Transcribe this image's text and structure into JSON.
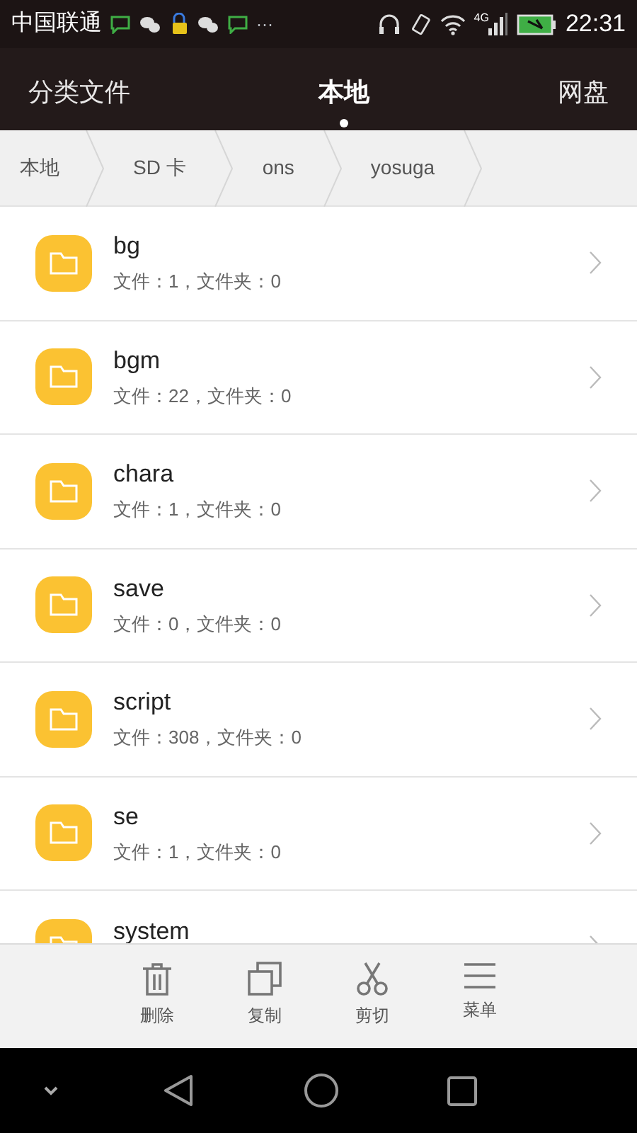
{
  "status_bar": {
    "carrier": "中国联通",
    "more": "···",
    "network": "4G",
    "time": "22:31"
  },
  "tabs": [
    {
      "label": "分类文件",
      "selected": false
    },
    {
      "label": "本地",
      "selected": true
    },
    {
      "label": "网盘",
      "selected": false
    }
  ],
  "breadcrumb": [
    "本地",
    "SD 卡",
    "ons",
    "yosuga"
  ],
  "folders": [
    {
      "name": "bg",
      "info": "文件：1，文件夹：0"
    },
    {
      "name": "bgm",
      "info": "文件：22，文件夹：0"
    },
    {
      "name": "chara",
      "info": "文件：1，文件夹：0"
    },
    {
      "name": "save",
      "info": "文件：0，文件夹：0"
    },
    {
      "name": "script",
      "info": "文件：308，文件夹：0"
    },
    {
      "name": "se",
      "info": "文件：1，文件夹：0"
    },
    {
      "name": "system"
    }
  ],
  "toolbar": [
    {
      "kind": "delete",
      "label": "删除"
    },
    {
      "kind": "copy",
      "label": "复制"
    },
    {
      "kind": "cut",
      "label": "剪切"
    },
    {
      "kind": "menu",
      "label": "菜单"
    }
  ]
}
